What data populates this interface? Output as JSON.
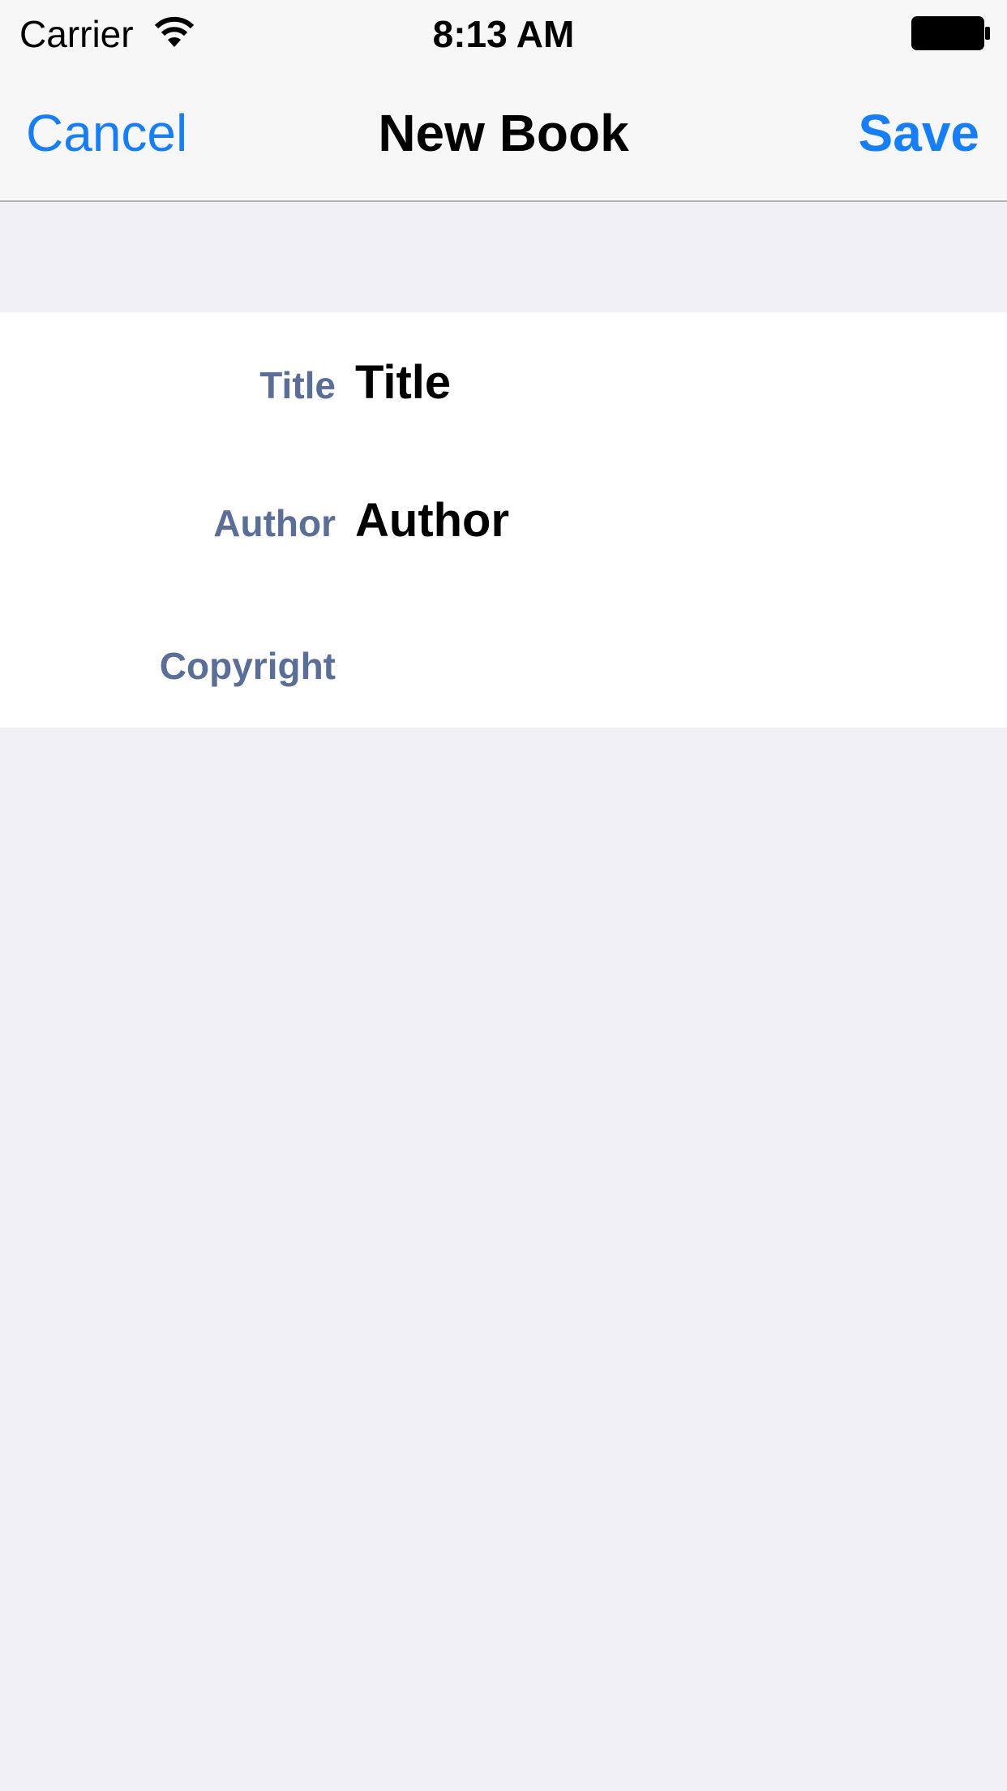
{
  "status_bar": {
    "carrier": "Carrier",
    "time": "8:13 AM",
    "wifi_icon": "wifi-icon",
    "battery_icon": "battery-icon"
  },
  "nav_bar": {
    "cancel_label": "Cancel",
    "title": "New Book",
    "save_label": "Save"
  },
  "form": {
    "fields": [
      {
        "label": "Title",
        "value": "Title"
      },
      {
        "label": "Author",
        "value": "Author"
      },
      {
        "label": "Copyright",
        "value": ""
      }
    ]
  },
  "colors": {
    "accent": "#157efb",
    "label": "#5a6e97",
    "background": "#efeff4",
    "bar": "#f7f7f8"
  }
}
